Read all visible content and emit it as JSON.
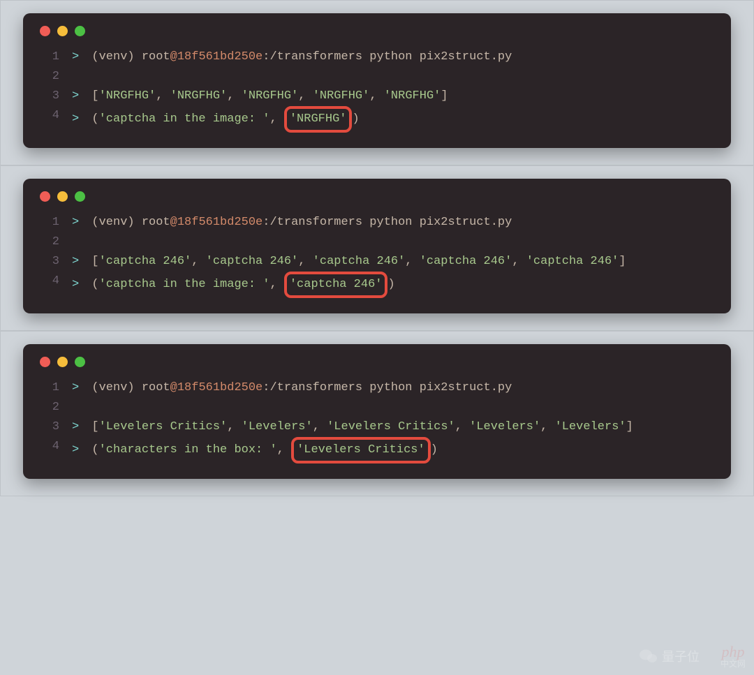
{
  "blocks": [
    {
      "lines": [
        {
          "num": "1",
          "prompt": ">",
          "type": "cmd",
          "venv": "(venv) ",
          "user": "root",
          "at": "@",
          "host": "18f561bd250e",
          "path": ":/transformers python pix2struct.py"
        },
        {
          "num": "2",
          "prompt": "",
          "type": "blank"
        },
        {
          "num": "3",
          "prompt": ">",
          "type": "list",
          "items": [
            "'NRGFHG'",
            "'NRGFHG'",
            "'NRGFHG'",
            "'NRGFHG'",
            "'NRGFHG'"
          ]
        },
        {
          "num": "4",
          "prompt": ">",
          "type": "tuple",
          "label": "'captcha in the image: '",
          "highlight": "'NRGFHG'"
        }
      ]
    },
    {
      "lines": [
        {
          "num": "1",
          "prompt": ">",
          "type": "cmd",
          "venv": "(venv) ",
          "user": "root",
          "at": "@",
          "host": "18f561bd250e",
          "path": ":/transformers python pix2struct.py"
        },
        {
          "num": "2",
          "prompt": "",
          "type": "blank"
        },
        {
          "num": "3",
          "prompt": ">",
          "type": "list",
          "items": [
            "'captcha 246'",
            "'captcha 246'",
            "'captcha 246'",
            "'captcha 246'",
            "'captcha 246'"
          ]
        },
        {
          "num": "4",
          "prompt": ">",
          "type": "tuple",
          "label": "'captcha in the image: '",
          "highlight": "'captcha 246'"
        }
      ]
    },
    {
      "lines": [
        {
          "num": "1",
          "prompt": ">",
          "type": "cmd",
          "venv": "(venv) ",
          "user": "root",
          "at": "@",
          "host": "18f561bd250e",
          "path": ":/transformers python pix2struct.py"
        },
        {
          "num": "2",
          "prompt": "",
          "type": "blank"
        },
        {
          "num": "3",
          "prompt": ">",
          "type": "list",
          "items": [
            "'Levelers Critics'",
            "'Levelers'",
            "'Levelers Critics'",
            "'Levelers'",
            "'Levelers'"
          ]
        },
        {
          "num": "4",
          "prompt": ">",
          "type": "tuple",
          "label": "'characters in the box: '",
          "highlight": "'Levelers Critics'"
        }
      ]
    }
  ],
  "watermark": {
    "left": "量子位",
    "right_top": "php",
    "right_bottom": "中文网"
  }
}
